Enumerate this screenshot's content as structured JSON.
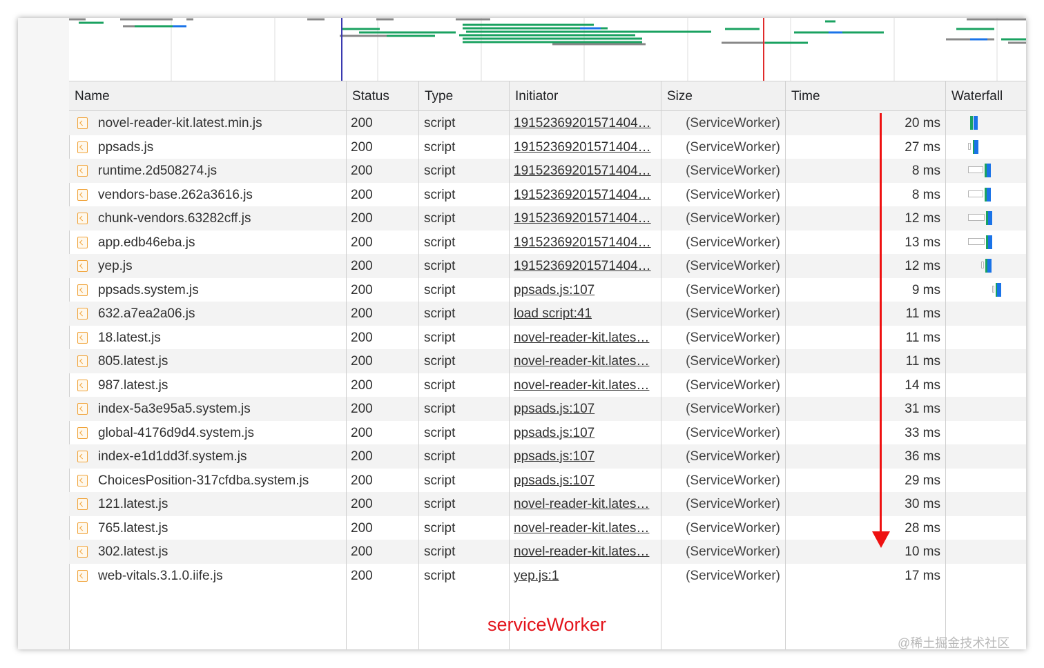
{
  "columns": {
    "name": "Name",
    "status": "Status",
    "type": "Type",
    "initiator": "Initiator",
    "size": "Size",
    "time": "Time",
    "waterfall": "Waterfall"
  },
  "rows": [
    {
      "name": "novel-reader-kit.latest.min.js",
      "status": "200",
      "type": "script",
      "initiator": "19152369201571404…",
      "size": "(ServiceWorker)",
      "time": "20 ms"
    },
    {
      "name": "ppsads.js",
      "status": "200",
      "type": "script",
      "initiator": "19152369201571404…",
      "size": "(ServiceWorker)",
      "time": "27 ms"
    },
    {
      "name": "runtime.2d508274.js",
      "status": "200",
      "type": "script",
      "initiator": "19152369201571404…",
      "size": "(ServiceWorker)",
      "time": "8 ms"
    },
    {
      "name": "vendors-base.262a3616.js",
      "status": "200",
      "type": "script",
      "initiator": "19152369201571404…",
      "size": "(ServiceWorker)",
      "time": "8 ms"
    },
    {
      "name": "chunk-vendors.63282cff.js",
      "status": "200",
      "type": "script",
      "initiator": "19152369201571404…",
      "size": "(ServiceWorker)",
      "time": "12 ms"
    },
    {
      "name": "app.edb46eba.js",
      "status": "200",
      "type": "script",
      "initiator": "19152369201571404…",
      "size": "(ServiceWorker)",
      "time": "13 ms"
    },
    {
      "name": "yep.js",
      "status": "200",
      "type": "script",
      "initiator": "19152369201571404…",
      "size": "(ServiceWorker)",
      "time": "12 ms"
    },
    {
      "name": "ppsads.system.js",
      "status": "200",
      "type": "script",
      "initiator": "ppsads.js:107",
      "size": "(ServiceWorker)",
      "time": "9 ms"
    },
    {
      "name": "632.a7ea2a06.js",
      "status": "200",
      "type": "script",
      "initiator": "load script:41",
      "size": "(ServiceWorker)",
      "time": "11 ms"
    },
    {
      "name": "18.latest.js",
      "status": "200",
      "type": "script",
      "initiator": "novel-reader-kit.lates…",
      "size": "(ServiceWorker)",
      "time": "11 ms"
    },
    {
      "name": "805.latest.js",
      "status": "200",
      "type": "script",
      "initiator": "novel-reader-kit.lates…",
      "size": "(ServiceWorker)",
      "time": "11 ms"
    },
    {
      "name": "987.latest.js",
      "status": "200",
      "type": "script",
      "initiator": "novel-reader-kit.lates…",
      "size": "(ServiceWorker)",
      "time": "14 ms"
    },
    {
      "name": "index-5a3e95a5.system.js",
      "status": "200",
      "type": "script",
      "initiator": "ppsads.js:107",
      "size": "(ServiceWorker)",
      "time": "31 ms"
    },
    {
      "name": "global-4176d9d4.system.js",
      "status": "200",
      "type": "script",
      "initiator": "ppsads.js:107",
      "size": "(ServiceWorker)",
      "time": "33 ms"
    },
    {
      "name": "index-e1d1dd3f.system.js",
      "status": "200",
      "type": "script",
      "initiator": "ppsads.js:107",
      "size": "(ServiceWorker)",
      "time": "36 ms"
    },
    {
      "name": "ChoicesPosition-317cfdba.system.js",
      "status": "200",
      "type": "script",
      "initiator": "ppsads.js:107",
      "size": "(ServiceWorker)",
      "time": "29 ms"
    },
    {
      "name": "121.latest.js",
      "status": "200",
      "type": "script",
      "initiator": "novel-reader-kit.lates…",
      "size": "(ServiceWorker)",
      "time": "30 ms"
    },
    {
      "name": "765.latest.js",
      "status": "200",
      "type": "script",
      "initiator": "novel-reader-kit.lates…",
      "size": "(ServiceWorker)",
      "time": "28 ms"
    },
    {
      "name": "302.latest.js",
      "status": "200",
      "type": "script",
      "initiator": "novel-reader-kit.lates…",
      "size": "(ServiceWorker)",
      "time": "10 ms"
    },
    {
      "name": "web-vitals.3.1.0.iife.js",
      "status": "200",
      "type": "script",
      "initiator": "yep.js:1",
      "size": "(ServiceWorker)",
      "time": "17 ms"
    }
  ],
  "annotation": "serviceWorker",
  "watermark": "@稀土掘金技术社区",
  "colors": {
    "annotation": "#e3141b",
    "arrow": "#ee1111",
    "waterfall_download": "#1a73e8",
    "waterfall_waiting": "#1aa260",
    "file_icon": "#f0a33a"
  },
  "icons": {
    "file": "script-file-icon"
  }
}
